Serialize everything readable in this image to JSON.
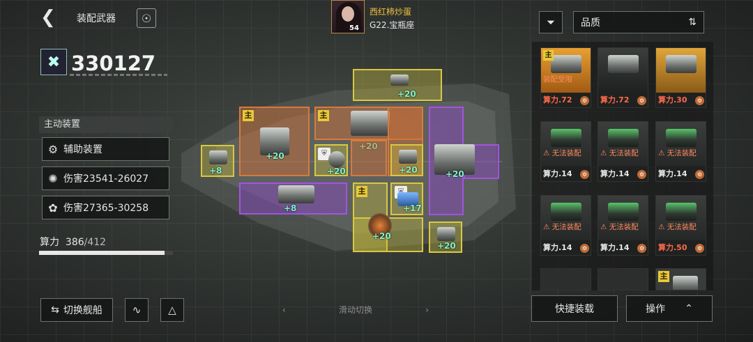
{
  "header": {
    "title": "装配武器",
    "back_icon": "chevron-left-icon",
    "planet_icon": "planet-icon"
  },
  "player": {
    "name": "西红柿炒蛋",
    "server": "G22.宝瓶座",
    "level": "54"
  },
  "power": {
    "value": "330127"
  },
  "left_panel": {
    "header": "主动装置",
    "items": [
      {
        "label": "辅助装置",
        "icon": "gear-icon"
      },
      {
        "label": "伤害23541-26027",
        "icon": "claw-icon"
      },
      {
        "label": "伤害27365-30258",
        "icon": "missile-icon"
      }
    ],
    "capacity_label": "算力",
    "capacity_used": "386",
    "capacity_max": "/412",
    "capacity_fraction": 0.937
  },
  "bottom": {
    "swap_label": "切换舰船",
    "slide_label": "滑动切换",
    "swap_icon": "swap-icon"
  },
  "slots": {
    "s1": "+20",
    "s2": "+20",
    "s3": "+20",
    "s4": "+8",
    "s5": "+20",
    "s6": "+20",
    "s7": "+20",
    "s8": "+8",
    "s9": "+17",
    "s10": "+20",
    "s11": "+20",
    "main_badge": "主"
  },
  "right_panel": {
    "sort_label": "品质",
    "filter_icon": "filter-icon",
    "cards": [
      {
        "cost": "算力.72",
        "badge": "主",
        "warn": "装配受限",
        "cost_color": "#ff6a4a"
      },
      {
        "cost": "算力.72",
        "badge": "",
        "warn": "",
        "cost_color": "#ff6a4a"
      },
      {
        "cost": "算力.30",
        "badge": "",
        "warn": "",
        "cost_color": "#ff6a4a"
      },
      {
        "cost": "算力.14",
        "badge": "",
        "warn": "无法装配",
        "cost_color": "#e8e8e8"
      },
      {
        "cost": "算力.14",
        "badge": "",
        "warn": "无法装配",
        "cost_color": "#e8e8e8"
      },
      {
        "cost": "算力.14",
        "badge": "",
        "warn": "无法装配",
        "cost_color": "#e8e8e8"
      },
      {
        "cost": "算力.14",
        "badge": "",
        "warn": "无法装配",
        "cost_color": "#e8e8e8"
      },
      {
        "cost": "算力.14",
        "badge": "",
        "warn": "无法装配",
        "cost_color": "#e8e8e8"
      },
      {
        "cost": "算力.50",
        "badge": "",
        "warn": "无法装配",
        "cost_color": "#ff6a4a"
      }
    ],
    "partial_badge": "主",
    "quick_label": "快捷装载",
    "op_label": "操作",
    "op_icon": "chevron-up-icon"
  }
}
